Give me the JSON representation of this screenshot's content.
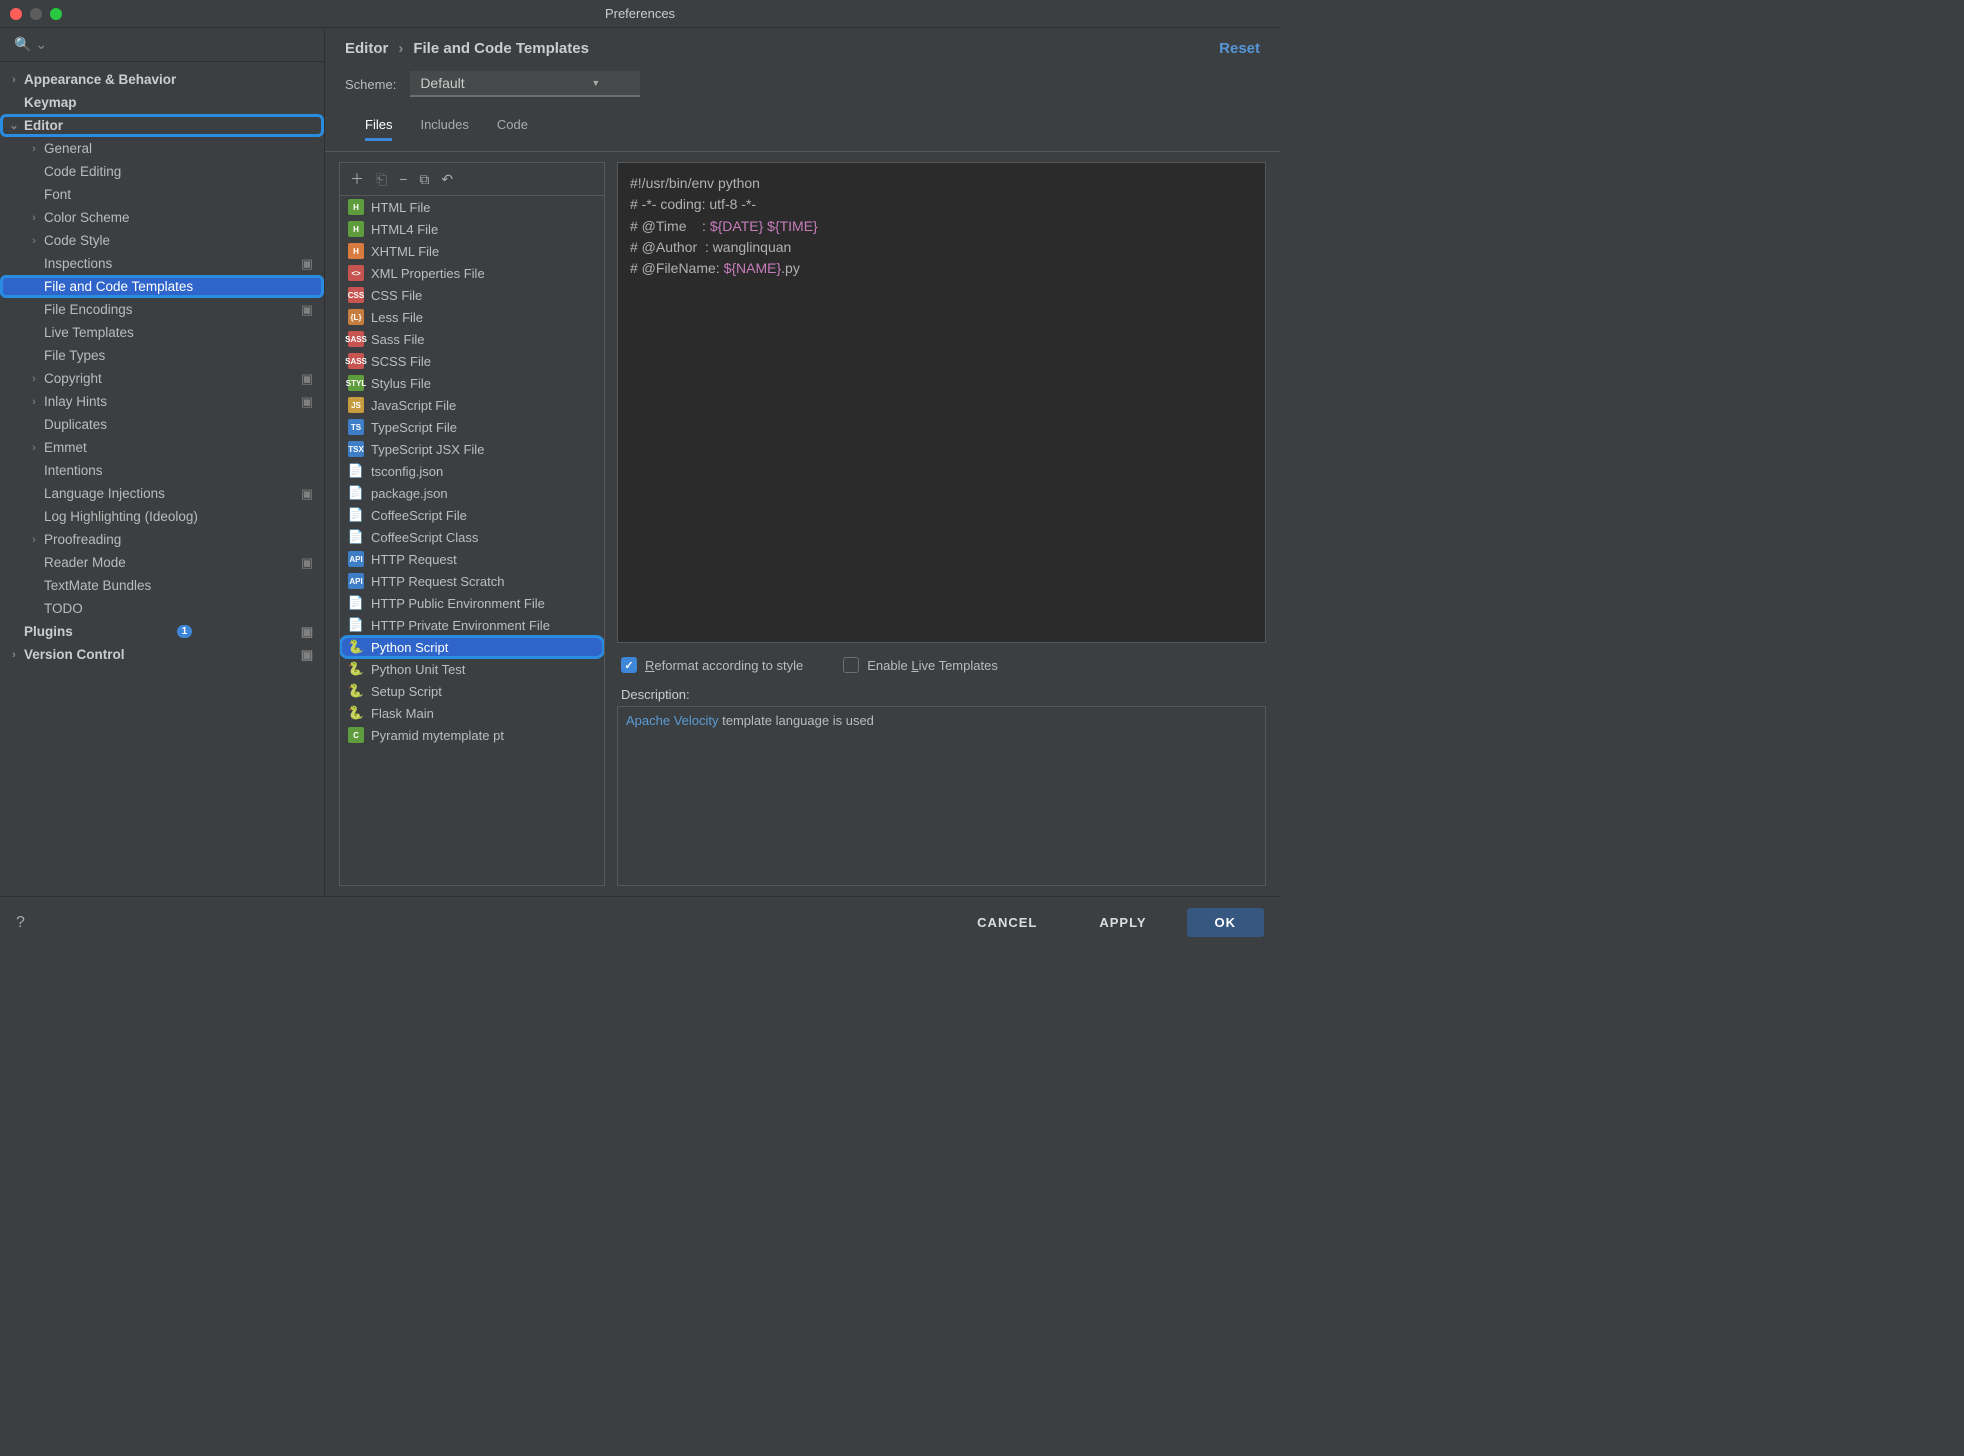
{
  "window": {
    "title": "Preferences"
  },
  "breadcrumb": {
    "root": "Editor",
    "page": "File and Code Templates"
  },
  "reset_label": "Reset",
  "scheme": {
    "label": "Scheme:",
    "value": "Default"
  },
  "tabs": {
    "files": "Files",
    "includes": "Includes",
    "code": "Code"
  },
  "sidebar": {
    "items": [
      {
        "label": "Appearance & Behavior",
        "chev": "›",
        "top": true
      },
      {
        "label": "Keymap",
        "top": true,
        "indent": 0
      },
      {
        "label": "Editor",
        "chev": "⌄",
        "top": true,
        "highlighted": true
      },
      {
        "label": "General",
        "chev": "›",
        "indent": 1
      },
      {
        "label": "Code Editing",
        "indent": 1
      },
      {
        "label": "Font",
        "indent": 1
      },
      {
        "label": "Color Scheme",
        "chev": "›",
        "indent": 1
      },
      {
        "label": "Code Style",
        "chev": "›",
        "indent": 1
      },
      {
        "label": "Inspections",
        "indent": 1,
        "gear": true
      },
      {
        "label": "File and Code Templates",
        "indent": 1,
        "selected": true,
        "highlighted": true
      },
      {
        "label": "File Encodings",
        "indent": 1,
        "gear": true
      },
      {
        "label": "Live Templates",
        "indent": 1
      },
      {
        "label": "File Types",
        "indent": 1
      },
      {
        "label": "Copyright",
        "chev": "›",
        "indent": 1,
        "gear": true
      },
      {
        "label": "Inlay Hints",
        "chev": "›",
        "indent": 1,
        "gear": true
      },
      {
        "label": "Duplicates",
        "indent": 1
      },
      {
        "label": "Emmet",
        "chev": "›",
        "indent": 1
      },
      {
        "label": "Intentions",
        "indent": 1
      },
      {
        "label": "Language Injections",
        "indent": 1,
        "gear": true
      },
      {
        "label": "Log Highlighting (Ideolog)",
        "indent": 1
      },
      {
        "label": "Proofreading",
        "chev": "›",
        "indent": 1
      },
      {
        "label": "Reader Mode",
        "indent": 1,
        "gear": true
      },
      {
        "label": "TextMate Bundles",
        "indent": 1
      },
      {
        "label": "TODO",
        "indent": 1
      },
      {
        "label": "Plugins",
        "top": true,
        "count": "1",
        "gear": true
      },
      {
        "label": "Version Control",
        "chev": "›",
        "top": true,
        "gear": true
      }
    ]
  },
  "templates": [
    {
      "label": "HTML File",
      "icon": "H",
      "bg": "#5e9c3e"
    },
    {
      "label": "HTML4 File",
      "icon": "H",
      "bg": "#5e9c3e"
    },
    {
      "label": "XHTML File",
      "icon": "H",
      "bg": "#d87b3e"
    },
    {
      "label": "XML Properties File",
      "icon": "<>",
      "bg": "#c75450"
    },
    {
      "label": "CSS File",
      "icon": "CSS",
      "bg": "#c75450"
    },
    {
      "label": "Less File",
      "icon": "{L}",
      "bg": "#c77d3e"
    },
    {
      "label": "Sass File",
      "icon": "SASS",
      "bg": "#c75450"
    },
    {
      "label": "SCSS File",
      "icon": "SASS",
      "bg": "#c75450"
    },
    {
      "label": "Stylus File",
      "icon": "STYL",
      "bg": "#5e9c3e"
    },
    {
      "label": "JavaScript File",
      "icon": "JS",
      "bg": "#c79c3e"
    },
    {
      "label": "TypeScript File",
      "icon": "TS",
      "bg": "#3e7ec7"
    },
    {
      "label": "TypeScript JSX File",
      "icon": "TSX",
      "bg": "#3e7ec7"
    },
    {
      "label": "tsconfig.json",
      "icon": "📄",
      "bg": "transparent"
    },
    {
      "label": "package.json",
      "icon": "📄",
      "bg": "transparent"
    },
    {
      "label": "CoffeeScript File",
      "icon": "📄",
      "bg": "transparent"
    },
    {
      "label": "CoffeeScript Class",
      "icon": "📄",
      "bg": "transparent"
    },
    {
      "label": "HTTP Request",
      "icon": "API",
      "bg": "#3e7ec7"
    },
    {
      "label": "HTTP Request Scratch",
      "icon": "API",
      "bg": "#3e7ec7"
    },
    {
      "label": "HTTP Public Environment File",
      "icon": "📄",
      "bg": "transparent"
    },
    {
      "label": "HTTP Private Environment File",
      "icon": "📄",
      "bg": "transparent"
    },
    {
      "label": "Python Script",
      "icon": "🐍",
      "bg": "transparent",
      "selected": true,
      "highlighted": true
    },
    {
      "label": "Python Unit Test",
      "icon": "🐍",
      "bg": "transparent"
    },
    {
      "label": "Setup Script",
      "icon": "🐍",
      "bg": "transparent"
    },
    {
      "label": "Flask Main",
      "icon": "🐍",
      "bg": "transparent"
    },
    {
      "label": "Pyramid mytemplate pt",
      "icon": "C",
      "bg": "#5e9c3e"
    }
  ],
  "code": {
    "l1a": "#!/usr/bin/env python",
    "l2a": "# -*- coding: utf-8 -*-",
    "l3a": "# @Time    : ",
    "l3b": "${DATE}",
    "l3c": " ",
    "l3d": "${TIME}",
    "l4a": "# @Author  : wanglinquan",
    "l5a": "# @FileName: ",
    "l5b": "${NAME}",
    "l5c": ".py"
  },
  "opts": {
    "reformat_pre": "R",
    "reformat_post": "eformat according to style",
    "live_pre": "Enable ",
    "live_u": "L",
    "live_post": "ive Templates"
  },
  "desc": {
    "label": "Description:",
    "link": "Apache Velocity",
    "rest": " template language is used"
  },
  "footer": {
    "cancel": "CANCEL",
    "apply": "APPLY",
    "ok": "OK"
  }
}
